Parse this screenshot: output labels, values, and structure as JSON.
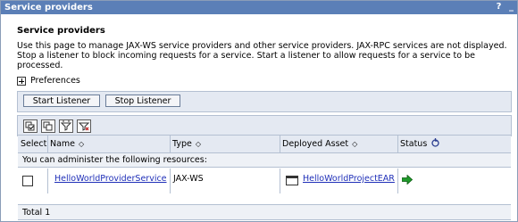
{
  "window": {
    "title": "Service providers",
    "help_label": "?",
    "minimize_label": "_"
  },
  "page": {
    "title": "Service providers",
    "description": "Use this page to manage JAX-WS service providers and other service providers. JAX-RPC services are not displayed. Stop a listener to block incoming requests for a service. Start a listener to allow requests for a service to be processed.",
    "preferences_label": "Preferences"
  },
  "buttons": {
    "start_listener": "Start Listener",
    "stop_listener": "Stop Listener"
  },
  "toolbar_icons": [
    "select-all-icon",
    "deselect-all-icon",
    "show-filter-icon",
    "clear-filter-icon"
  ],
  "table": {
    "headers": {
      "select": "Select",
      "name": "Name",
      "type": "Type",
      "deployed_asset": "Deployed Asset",
      "status": "Status"
    },
    "resources_message": "You can administer the following resources:",
    "rows": [
      {
        "name": "HelloWorldProviderService",
        "type": "JAX-WS",
        "deployed_asset": "HelloWorldProjectEAR",
        "status_icon": "started-arrow-icon"
      }
    ],
    "total": "Total 1"
  },
  "colors": {
    "titlebar": "#5b7fb7",
    "link": "#1f2fb8",
    "status_started": "#1f9a2a"
  }
}
